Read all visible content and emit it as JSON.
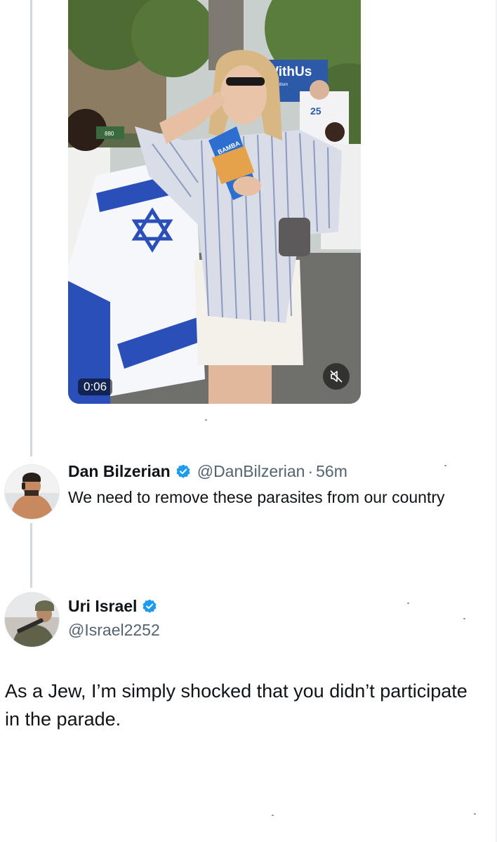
{
  "thread": {
    "media": {
      "duration": "0:06",
      "banner_text": "WithUs",
      "banner_subtext": "ting Antisemitism",
      "snack_label": "BAMBA",
      "shirt_number": "25",
      "sign_number": "880",
      "mute_icon": "muted-speaker-icon"
    },
    "reply": {
      "display_name": "Dan Bilzerian",
      "verified_icon": "verified-badge-icon",
      "handle": "@DanBilzerian",
      "separator": "·",
      "time": "56m",
      "text": "We need to remove these parasites from our country"
    },
    "main_post": {
      "display_name": "Uri Israel",
      "verified_icon": "verified-badge-icon",
      "handle": "@Israel2252",
      "text": "As a Jew, I’m simply shocked that you didn’t participate in the parade."
    }
  },
  "colors": {
    "verified_blue": "#1d9bf0",
    "secondary_text": "#536471",
    "thread_line": "#cfd9de"
  }
}
